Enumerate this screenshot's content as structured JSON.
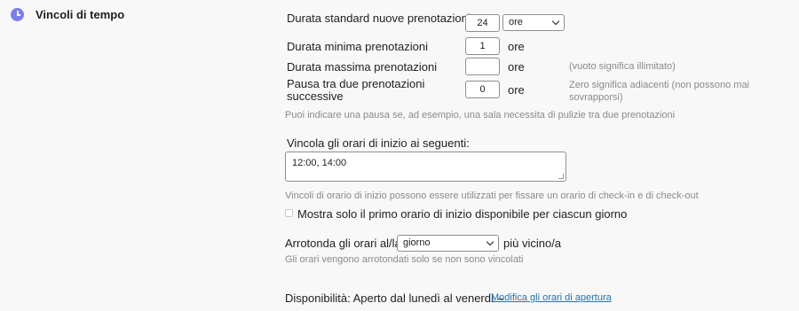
{
  "section": {
    "title": "Vincoli di tempo",
    "icon": "clock-icon"
  },
  "default_duration": {
    "label": "Durata standard nuove prenotazioni",
    "value": "24",
    "unit": "ore"
  },
  "min_duration": {
    "label": "Durata minima prenotazioni",
    "value": "1",
    "unit": "ore"
  },
  "max_duration": {
    "label": "Durata massima prenotazioni",
    "value": "",
    "unit": "ore",
    "help": "(vuoto significa illimitato)"
  },
  "pause": {
    "label_line1": "Pausa tra due prenotazioni",
    "label_line2": "successive",
    "value": "0",
    "unit": "ore",
    "help_line1": "Zero significa adiacenti (non possono mai",
    "help_line2": "sovrapporsi)"
  },
  "pause_help": "Puoi indicare una pausa se, ad esempio, una sala necessita di pulizie tra due prenotazioni",
  "start_times": {
    "label": "Vincola gli orari di inizio ai seguenti:",
    "value": "12:00, 14:00",
    "help": "Vincoli di orario di inizio possono essere utilizzati per fissare un orario di check-in e di check-out"
  },
  "first_only": {
    "label": "Mostra solo il primo orario di inizio disponibile per ciascun giorno",
    "checked": false
  },
  "rounding": {
    "label_before": "Arrotonda gli orari al/la",
    "value": "giorno",
    "label_after": "più vicino/a",
    "help": "Gli orari vengono arrotondati solo se non sono vincolati"
  },
  "availability": {
    "text": "Disponibilità: Aperto dal lunedì al venerdì –",
    "link": "Modifica gli orari di apertura"
  }
}
